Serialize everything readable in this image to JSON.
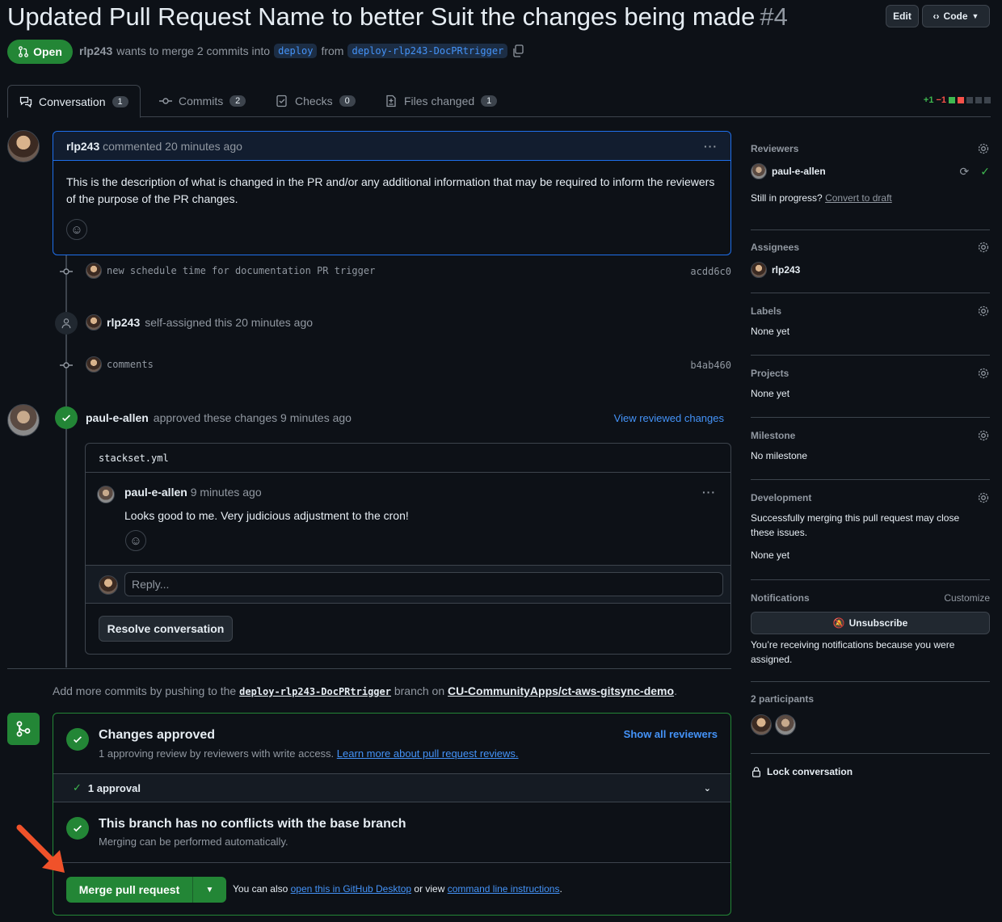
{
  "header": {
    "title": "Updated Pull Request Name to better Suit the changes being made",
    "number": "#4",
    "edit_label": "Edit",
    "code_label": "Code"
  },
  "status": {
    "state": "Open",
    "author": "rlp243",
    "merge_text": "wants to merge 2 commits into",
    "base_branch": "deploy",
    "from_text": "from",
    "head_branch": "deploy-rlp243-DocPRtrigger"
  },
  "tabs": [
    {
      "label": "Conversation",
      "count": "1"
    },
    {
      "label": "Commits",
      "count": "2"
    },
    {
      "label": "Checks",
      "count": "0"
    },
    {
      "label": "Files changed",
      "count": "1"
    }
  ],
  "diffstat": {
    "add": "+1",
    "del": "−1"
  },
  "comment": {
    "author": "rlp243",
    "meta": "commented 20 minutes ago",
    "body": "This is the description of what is changed in the PR and/or any additional information that may be required to inform the reviewers of the purpose of the PR changes."
  },
  "timeline": {
    "commit1": {
      "message": "new schedule time for documentation PR trigger",
      "sha": "acdd6c0"
    },
    "assign": {
      "author": "rlp243",
      "text": "self-assigned this 20 minutes ago"
    },
    "commit2": {
      "message": "comments",
      "sha": "b4ab460"
    }
  },
  "review": {
    "author": "paul-e-allen",
    "text": "approved these changes 9 minutes ago",
    "view_link": "View reviewed changes",
    "file": "stackset.yml",
    "comment_author": "paul-e-allen",
    "comment_time": "9 minutes ago",
    "comment_body": "Looks good to me. Very judicious adjustment to the cron!",
    "reply_placeholder": "Reply...",
    "resolve_label": "Resolve conversation"
  },
  "push_hint": {
    "prefix": "Add more commits by pushing to the",
    "branch": "deploy-rlp243-DocPRtrigger",
    "middle": "branch on",
    "repo": "CU-CommunityApps/ct-aws-gitsync-demo",
    "suffix": "."
  },
  "merge": {
    "approved_title": "Changes approved",
    "approved_sub": "1 approving review by reviewers with write access.",
    "approved_link": "Learn more about pull request reviews.",
    "show_reviewers": "Show all reviewers",
    "approval_count": "1 approval",
    "conflict_title": "This branch has no conflicts with the base branch",
    "conflict_sub": "Merging can be performed automatically.",
    "merge_button": "Merge pull request",
    "also_text": "You can also",
    "desktop_link": "open this in GitHub Desktop",
    "or_view": "or view",
    "cli_link": "command line instructions",
    "end": "."
  },
  "sidebar": {
    "reviewers": {
      "title": "Reviewers",
      "name": "paul-e-allen",
      "draft_q": "Still in progress?",
      "draft_link": "Convert to draft"
    },
    "assignees": {
      "title": "Assignees",
      "name": "rlp243"
    },
    "labels": {
      "title": "Labels",
      "value": "None yet"
    },
    "projects": {
      "title": "Projects",
      "value": "None yet"
    },
    "milestone": {
      "title": "Milestone",
      "value": "No milestone"
    },
    "development": {
      "title": "Development",
      "text": "Successfully merging this pull request may close these issues.",
      "value": "None yet"
    },
    "notifications": {
      "title": "Notifications",
      "customize": "Customize",
      "button": "Unsubscribe",
      "text": "You’re receiving notifications because you were assigned."
    },
    "participants": {
      "title": "2 participants"
    },
    "lock": "Lock conversation"
  },
  "colors": {
    "accent": "#238636",
    "link": "#4493f8",
    "border": "#3d444d",
    "background": "#0d1117",
    "arrow": "#f0522a"
  }
}
